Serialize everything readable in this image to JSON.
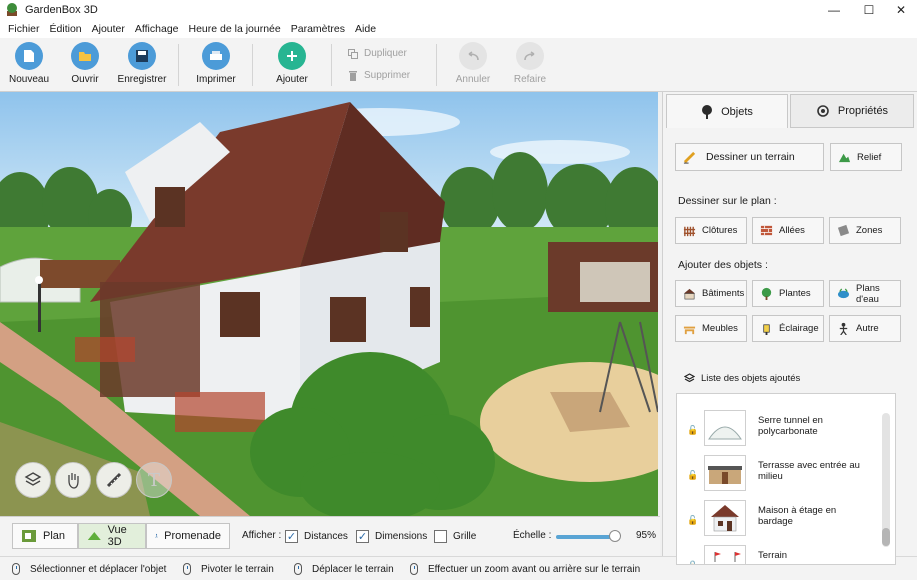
{
  "app": {
    "title": "GardenBox 3D"
  },
  "menu": [
    "Fichier",
    "Édition",
    "Ajouter",
    "Affichage",
    "Heure de la journée",
    "Paramètres",
    "Aide"
  ],
  "toolbar": {
    "new": "Nouveau",
    "open": "Ouvrir",
    "save": "Enregistrer",
    "print": "Imprimer",
    "add": "Ajouter",
    "duplicate": "Dupliquer",
    "delete": "Supprimer",
    "undo": "Annuler",
    "redo": "Refaire"
  },
  "viewport_tools": [
    "objects-icon",
    "hand-icon",
    "ruler-icon",
    "text-icon"
  ],
  "bottom": {
    "modes": {
      "plan": "Plan",
      "view3d": "Vue 3D",
      "walk": "Promenade"
    },
    "show_label": "Afficher :",
    "checks": {
      "distances": "Distances",
      "dimensions": "Dimensions",
      "grid": "Grille"
    },
    "scale_label": "Échelle :",
    "scale_value": "95%",
    "scale_level": 95
  },
  "status": {
    "select": "Sélectionner et déplacer l'objet",
    "rotate": "Pivoter le terrain",
    "move": "Déplacer le terrain",
    "zoom": "Effectuer un zoom avant ou arrière sur le terrain"
  },
  "panel": {
    "tabs": {
      "objects": "Objets",
      "properties": "Propriétés"
    },
    "draw_terrain": "Dessiner un terrain",
    "relief": "Relief",
    "draw_on_plan": "Dessiner sur le plan :",
    "fences": "Clôtures",
    "paths": "Allées",
    "zones": "Zones",
    "add_objects": "Ajouter des objets :",
    "buildings": "Bâtiments",
    "plants": "Plantes",
    "water": "Plans d'eau",
    "furniture": "Meubles",
    "lighting": "Éclairage",
    "other": "Autre",
    "list_title": "Liste des objets ajoutés",
    "items": [
      "Serre tunnel en polycarbonate",
      "Terrasse avec entrée au milieu",
      "Maison à étage en bardage",
      "Terrain"
    ]
  },
  "colors": {
    "accent": "#2a6aa8",
    "add_green": "#27b592",
    "active_view": "#e2efdb"
  }
}
